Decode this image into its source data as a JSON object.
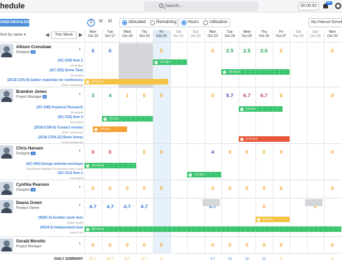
{
  "app": {
    "title": "hedule",
    "search_placeholder": "Search...",
    "clock": "00:00:00",
    "bell_badge": "99+"
  },
  "toolbar": {
    "unscheduled": "UNSCHEDULED",
    "view_d": "D",
    "view_w": "W",
    "view_m": "M",
    "allocated": "Allocated",
    "remaining": "Remaining",
    "hours": "Hours",
    "utilization": "Utilization",
    "filter": "My Filtered Sched..."
  },
  "nav": {
    "sort_by": "Sort by name ▾",
    "prev": "◀",
    "this_week": "This Week",
    "next": "▶"
  },
  "days": [
    {
      "d": "Mon",
      "n": "Oct 16"
    },
    {
      "d": "Tue",
      "n": "Oct 17"
    },
    {
      "d": "Wed",
      "n": "Oct 18"
    },
    {
      "d": "Thu",
      "n": "Oct 19"
    },
    {
      "d": "Fri",
      "n": "Oct 20"
    },
    {
      "d": "Sat",
      "n": "Oct 21"
    },
    {
      "d": "Sun",
      "n": "Oct 22"
    },
    {
      "d": "Mon",
      "n": "Oct 23"
    },
    {
      "d": "Tue",
      "n": "Oct 24"
    },
    {
      "d": "Wed",
      "n": "Oct 25"
    },
    {
      "d": "Thu",
      "n": "Oct 26"
    },
    {
      "d": "Fri",
      "n": "Oct 27"
    },
    {
      "d": "Sat",
      "n": "Oct 28"
    },
    {
      "d": "Sun",
      "n": "Oct 29"
    },
    {
      "d": "Mon",
      "n": "Oct 30"
    }
  ],
  "people": [
    {
      "name": "Allison Crenshaw",
      "role": "Designer",
      "badge": "+1",
      "values": [
        "6",
        "6",
        "",
        "",
        "0",
        "",
        "",
        "0",
        "2.5",
        "2.5",
        "2.5",
        "0",
        "",
        "",
        "0"
      ]
    },
    {
      "name": "Brandon Jones",
      "role": "Project Manager",
      "badge": "+1",
      "values": [
        "3",
        "4",
        "1",
        "0",
        "0",
        "",
        "",
        "0",
        "5.7",
        "6.7",
        "6.7",
        "0",
        "",
        "",
        "0"
      ]
    },
    {
      "name": "Chris Hansen",
      "role": "Designer",
      "badge": "+1",
      "values": [
        "8",
        "8",
        "",
        "0",
        "0",
        "",
        "",
        "4",
        "0",
        "0",
        "0",
        "0",
        "",
        "",
        "0"
      ]
    },
    {
      "name": "Cynthia Pearson",
      "role": "Designer",
      "badge": "+1",
      "values": [
        "0",
        "0",
        "0",
        "0",
        "0",
        "",
        "",
        "0",
        "0",
        "0",
        "0",
        "0",
        "",
        "",
        "0"
      ]
    },
    {
      "name": "Deana Green",
      "role": "Product Owner",
      "badge": "",
      "values": [
        "4.7",
        "4.7",
        "4.7",
        "4.7",
        "",
        "",
        "",
        "4.7",
        "",
        "",
        "0",
        "",
        "",
        "0",
        ""
      ]
    },
    {
      "name": "Gerald Morello",
      "role": "Project Manager",
      "badge": "",
      "values": [
        "0",
        "0",
        "0",
        "0",
        "0",
        "",
        "",
        "0",
        "0",
        "0",
        "0",
        "0",
        "",
        "",
        "0"
      ]
    }
  ],
  "tasks": [
    {
      "title": "(AC-019) Item 1",
      "sub": "No project"
    },
    {
      "title": "(AC-335) Some Task",
      "sub": "No project"
    },
    {
      "title": "(2018-CON-8) Gather materials for conference",
      "sub": "2018 Conference"
    },
    {
      "title": "(AC-648) Keyword Research",
      "sub": "No project"
    },
    {
      "title": "(AC-316) Item 2",
      "sub": "No project"
    },
    {
      "title": "(2018-CON-6) Contact venues",
      "sub": "2018 Conference"
    },
    {
      "title": "(2018-CON-12) Book Venue",
      "sub": "2018 Conference"
    },
    {
      "title": "(AC-594) Design website mockups",
      "sub": "WordPress Website For Awesome New Client"
    },
    {
      "title": "(AC-311) Item 1",
      "sub": "No project"
    },
    {
      "title": "(0025-3) Another work item",
      "sub": "Client House"
    },
    {
      "title": "(0034-5) Independent task",
      "sub": "New To All"
    }
  ],
  "bars": [
    {
      "label": "4 hours"
    },
    {
      "label": "10 hours"
    },
    {
      "label": "10 hours"
    },
    {
      "label": "2 hours"
    },
    {
      "label": "3 hours"
    },
    {
      "label": "6 hours"
    },
    {
      "label": "17 hours"
    },
    {
      "label": "15 hours"
    },
    {
      "label": "4 hours"
    },
    {
      "label": "8 hours"
    },
    {
      "label": "28 hours"
    }
  ],
  "summary": {
    "label": "DAILY SUMMARY",
    "values": [
      "21.7",
      "22.7",
      "5.7",
      "5.7",
      "0",
      "",
      "",
      "4.7",
      "10",
      "10",
      "10",
      "0",
      "",
      "",
      "0"
    ]
  },
  "colors": {
    "accent": "#3d7fd6",
    "green": "#3cc46e",
    "yellow": "#f4c343",
    "orange": "#f5a035",
    "red": "#e8573a"
  }
}
